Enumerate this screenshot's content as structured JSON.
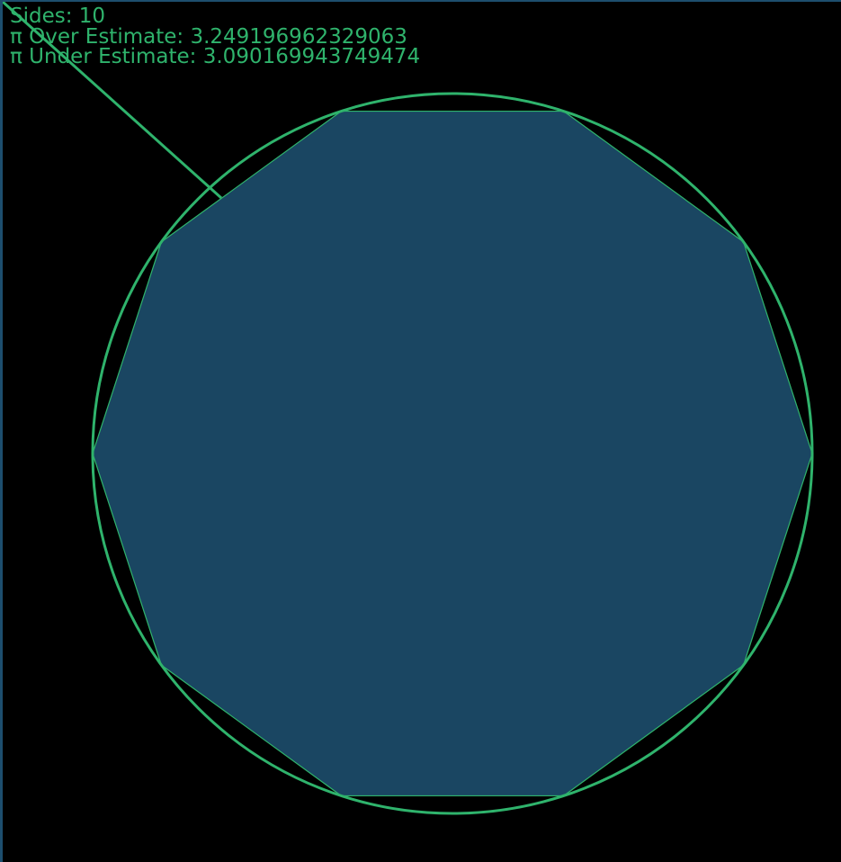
{
  "stats": {
    "sides_label": "Sides: 10",
    "over_label": "π Over Estimate: 3.249196962329063",
    "under_label": "π Under Estimate: 3.090169943749474"
  },
  "geometry": {
    "sides": 10
  },
  "colors": {
    "background": "#000000",
    "circle_stroke": "#2fb36c",
    "polygon_fill": "#1a4662",
    "polygon_stroke": "#2fb36c",
    "text": "#2fb36c",
    "frame_border": "#1d4e6e"
  }
}
